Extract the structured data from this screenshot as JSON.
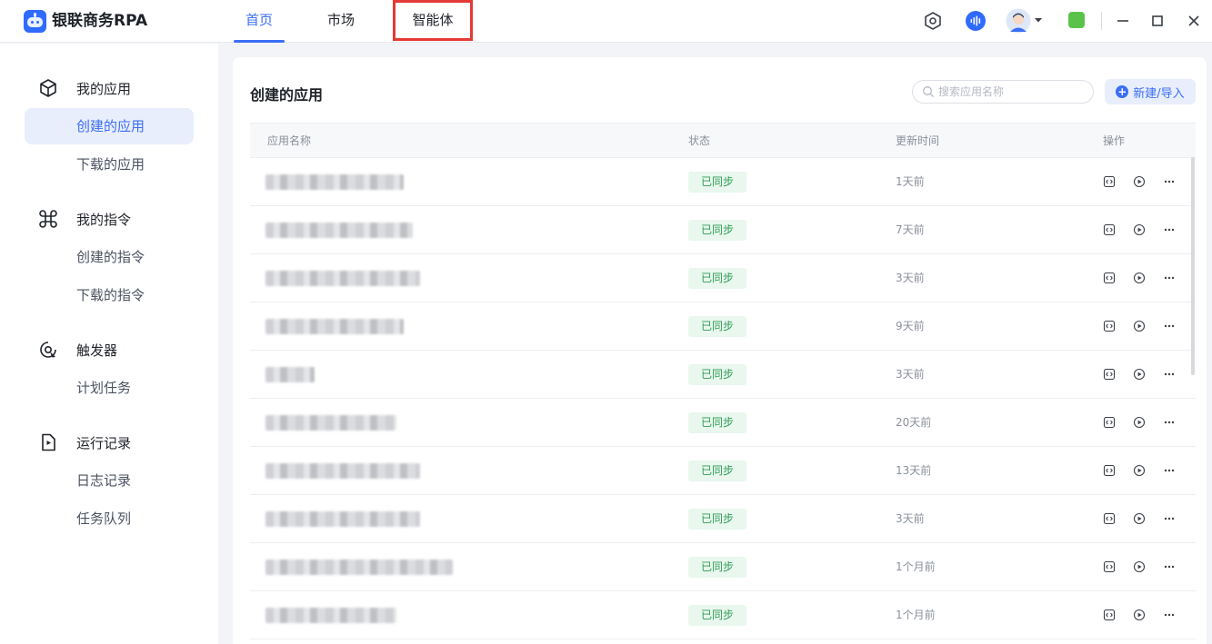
{
  "app": {
    "title": "银联商务RPA"
  },
  "tabs": [
    {
      "label": "首页",
      "active": true
    },
    {
      "label": "市场",
      "active": false
    },
    {
      "label": "智能体",
      "active": false,
      "highlighted": true
    }
  ],
  "toolbar_icons": [
    "settings-hexagon-icon",
    "voice-assistant-icon",
    "user-avatar-icon",
    "chevron-down-icon",
    "status-indicator-icon",
    "minimize-icon",
    "maximize-icon",
    "close-icon"
  ],
  "sidebar": {
    "groups": [
      {
        "label": "我的应用",
        "icon": "cube-icon",
        "items": [
          {
            "label": "创建的应用",
            "active": true
          },
          {
            "label": "下载的应用",
            "active": false
          }
        ]
      },
      {
        "label": "我的指令",
        "icon": "command-icon",
        "items": [
          {
            "label": "创建的指令",
            "active": false
          },
          {
            "label": "下载的指令",
            "active": false
          }
        ]
      },
      {
        "label": "触发器",
        "icon": "target-icon",
        "items": [
          {
            "label": "计划任务",
            "active": false
          }
        ]
      },
      {
        "label": "运行记录",
        "icon": "play-file-icon",
        "items": [
          {
            "label": "日志记录",
            "active": false
          },
          {
            "label": "任务队列",
            "active": false
          }
        ]
      }
    ]
  },
  "main": {
    "title": "创建的应用",
    "search_placeholder": "搜索应用名称",
    "new_button_label": "新建/导入",
    "columns": [
      "应用名称",
      "状态",
      "更新时间",
      "操作"
    ],
    "row_actions": [
      "code-icon",
      "play-icon",
      "more-icon"
    ],
    "rows": [
      {
        "name": "",
        "status": "已同步",
        "updated": "1天前"
      },
      {
        "name": "",
        "status": "已同步",
        "updated": "7天前"
      },
      {
        "name": "",
        "status": "已同步",
        "updated": "3天前"
      },
      {
        "name": "",
        "status": "已同步",
        "updated": "9天前"
      },
      {
        "name": "",
        "status": "已同步",
        "updated": "3天前"
      },
      {
        "name": "",
        "status": "已同步",
        "updated": "20天前"
      },
      {
        "name": "",
        "status": "已同步",
        "updated": "13天前"
      },
      {
        "name": "",
        "status": "已同步",
        "updated": "3天前"
      },
      {
        "name": "",
        "status": "已同步",
        "updated": "1个月前"
      },
      {
        "name": "",
        "status": "已同步",
        "updated": "1个月前"
      }
    ]
  },
  "colors": {
    "accent": "#3b6ef5",
    "status_green": "#2e9d56",
    "highlight_red": "#e53935",
    "status_indicator": "#5ac24a"
  }
}
